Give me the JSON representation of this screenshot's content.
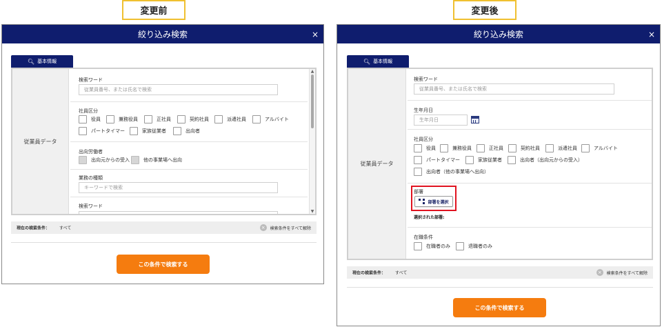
{
  "labels": {
    "before": "変更前",
    "after": "変更後"
  },
  "before": {
    "title": "絞り込み検索",
    "close": "×",
    "tab": "基本情報",
    "left_label": "従業員データ",
    "keyword_title": "検索ワード",
    "keyword_placeholder": "従業員番号、または氏名で検索",
    "emp_type_title": "社員区分",
    "emp_types": [
      "役員",
      "兼務役員",
      "正社員",
      "契約社員",
      "派遣社員",
      "アルバイト",
      "パートタイマー",
      "家族従業者",
      "出向者"
    ],
    "secondment_title": "出向労働者",
    "secondment_opts": [
      "出向元からの受入",
      "他の事業場へ出向"
    ],
    "job_title": "業務の種類",
    "job_placeholder": "キーワードで検索",
    "keyword2_title": "検索ワード",
    "cond_label": "現在の検索条件：",
    "cond_value": "すべて",
    "clear_label": "検索条件をすべて解除",
    "search_button": "この条件で検索する"
  },
  "after": {
    "title": "絞り込み検索",
    "close": "×",
    "tab": "基本情報",
    "left_label": "従業員データ",
    "keyword_title": "検索ワード",
    "keyword_placeholder": "従業員番号、または氏名で検索",
    "birth_title": "生年月日",
    "birth_placeholder": "生年月日",
    "emp_type_title": "社員区分",
    "emp_types": [
      "役員",
      "兼務役員",
      "正社員",
      "契約社員",
      "派遣社員",
      "アルバイト",
      "パートタイマー",
      "家族従業者",
      "出向者（出向元からの受入）",
      "出向者（他の事業場へ出向）"
    ],
    "dept_title": "部署",
    "dept_button": "部署を選択",
    "dept_selected": "選択された部署:",
    "tenure_title": "在職条件",
    "tenure_opts": [
      "在職者のみ",
      "退職者のみ"
    ],
    "cond_label": "現在の検索条件：",
    "cond_value": "すべて",
    "clear_label": "検索条件をすべて解除",
    "search_button": "この条件で検索する"
  },
  "colors": {
    "header": "#0f1d6e",
    "accent": "#f57c0f",
    "highlight": "#e0121f",
    "tag_border": "#f0c030"
  }
}
